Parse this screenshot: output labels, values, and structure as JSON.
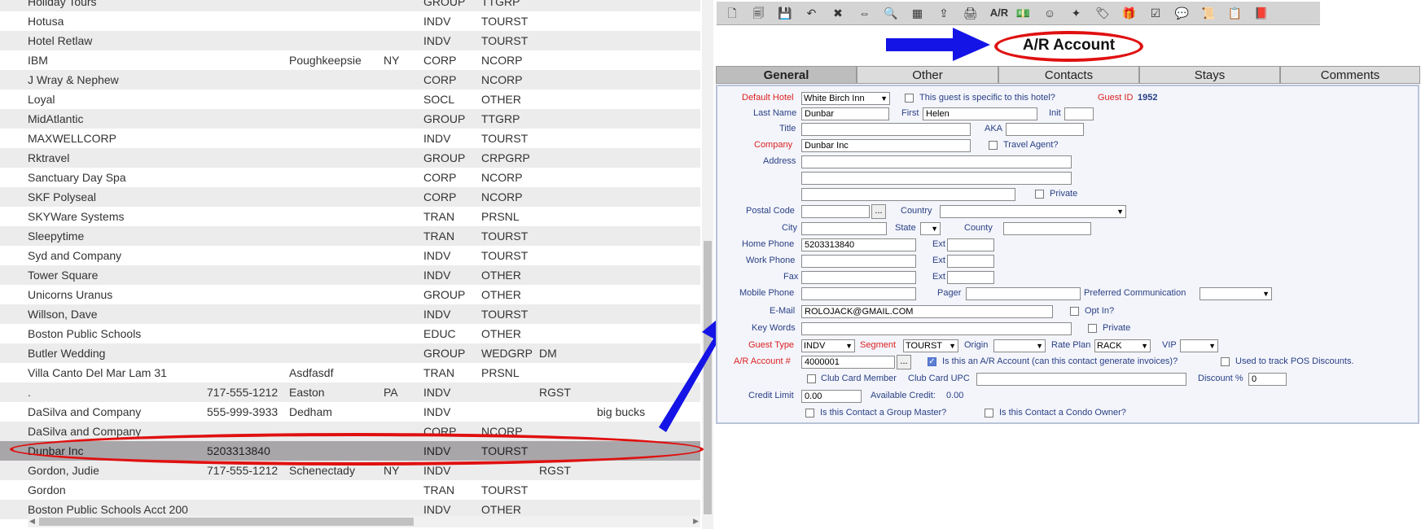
{
  "list": {
    "rows": [
      {
        "name": "Holiday Tours",
        "phone": "",
        "city": "",
        "state": "",
        "type": "GROUP",
        "segment": "TTGRP",
        "extra": "",
        "note": ""
      },
      {
        "name": "Hotusa",
        "phone": "",
        "city": "",
        "state": "",
        "type": "INDV",
        "segment": "TOURST",
        "extra": "",
        "note": ""
      },
      {
        "name": "Hotel Retlaw",
        "phone": "",
        "city": "",
        "state": "",
        "type": "INDV",
        "segment": "TOURST",
        "extra": "",
        "note": ""
      },
      {
        "name": "IBM",
        "phone": "",
        "city": "Poughkeepsie",
        "state": "NY",
        "type": "CORP",
        "segment": "NCORP",
        "extra": "",
        "note": ""
      },
      {
        "name": "J Wray & Nephew",
        "phone": "",
        "city": "",
        "state": "",
        "type": "CORP",
        "segment": "NCORP",
        "extra": "",
        "note": ""
      },
      {
        "name": "Loyal",
        "phone": "",
        "city": "",
        "state": "",
        "type": "SOCL",
        "segment": "OTHER",
        "extra": "",
        "note": ""
      },
      {
        "name": "MidAtlantic",
        "phone": "",
        "city": "",
        "state": "",
        "type": "GROUP",
        "segment": "TTGRP",
        "extra": "",
        "note": ""
      },
      {
        "name": "MAXWELLCORP",
        "phone": "",
        "city": "",
        "state": "",
        "type": "INDV",
        "segment": "TOURST",
        "extra": "",
        "note": ""
      },
      {
        "name": "Rktravel",
        "phone": "",
        "city": "",
        "state": "",
        "type": "GROUP",
        "segment": "CRPGRP",
        "extra": "",
        "note": ""
      },
      {
        "name": "Sanctuary Day Spa",
        "phone": "",
        "city": "",
        "state": "",
        "type": "CORP",
        "segment": "NCORP",
        "extra": "",
        "note": ""
      },
      {
        "name": "SKF Polyseal",
        "phone": "",
        "city": "",
        "state": "",
        "type": "CORP",
        "segment": "NCORP",
        "extra": "",
        "note": ""
      },
      {
        "name": "SKYWare Systems",
        "phone": "",
        "city": "",
        "state": "",
        "type": "TRAN",
        "segment": "PRSNL",
        "extra": "",
        "note": ""
      },
      {
        "name": "Sleepytime",
        "phone": "",
        "city": "",
        "state": "",
        "type": "TRAN",
        "segment": "TOURST",
        "extra": "",
        "note": ""
      },
      {
        "name": "Syd and Company",
        "phone": "",
        "city": "",
        "state": "",
        "type": "INDV",
        "segment": "TOURST",
        "extra": "",
        "note": ""
      },
      {
        "name": "Tower Square",
        "phone": "",
        "city": "",
        "state": "",
        "type": "INDV",
        "segment": "OTHER",
        "extra": "",
        "note": ""
      },
      {
        "name": "Unicorns Uranus",
        "phone": "",
        "city": "",
        "state": "",
        "type": "GROUP",
        "segment": "OTHER",
        "extra": "",
        "note": ""
      },
      {
        "name": "Willson, Dave",
        "phone": "",
        "city": "",
        "state": "",
        "type": "INDV",
        "segment": "TOURST",
        "extra": "",
        "note": ""
      },
      {
        "name": "Boston Public Schools",
        "phone": "",
        "city": "",
        "state": "",
        "type": "EDUC",
        "segment": "OTHER",
        "extra": "",
        "note": ""
      },
      {
        "name": "Butler Wedding",
        "phone": "",
        "city": "",
        "state": "",
        "type": "GROUP",
        "segment": "WEDGRP",
        "extra": "DM",
        "note": ""
      },
      {
        "name": "Villa Canto Del Mar Lam 31",
        "phone": "",
        "city": "Asdfasdf",
        "state": "",
        "type": "TRAN",
        "segment": "PRSNL",
        "extra": "",
        "note": ""
      },
      {
        "name": ".",
        "phone": "717-555-1212",
        "city": "Easton",
        "state": "PA",
        "type": "INDV",
        "segment": "",
        "extra": "RGST",
        "note": ""
      },
      {
        "name": "DaSilva and Company",
        "phone": "555-999-3933",
        "city": "Dedham",
        "state": "",
        "type": "INDV",
        "segment": "",
        "extra": "",
        "note": "big bucks"
      },
      {
        "name": "DaSilva and Company",
        "phone": "",
        "city": "",
        "state": "",
        "type": "CORP",
        "segment": "NCORP",
        "extra": "",
        "note": ""
      },
      {
        "name": "Dunbar Inc",
        "phone": "5203313840",
        "city": "",
        "state": "",
        "type": "INDV",
        "segment": "TOURST",
        "extra": "",
        "note": ""
      },
      {
        "name": "Gordon, Judie",
        "phone": "717-555-1212",
        "city": "Schenectady",
        "state": "NY",
        "type": "INDV",
        "segment": "",
        "extra": "RGST",
        "note": ""
      },
      {
        "name": "Gordon",
        "phone": "",
        "city": "",
        "state": "",
        "type": "TRAN",
        "segment": "TOURST",
        "extra": "",
        "note": ""
      },
      {
        "name": "Boston Public Schools Acct 200",
        "phone": "",
        "city": "",
        "state": "",
        "type": "INDV",
        "segment": "OTHER",
        "extra": "",
        "note": ""
      }
    ]
  },
  "annotation": {
    "callout": "A/R Account",
    "arrow_color": "#1414e6",
    "highlight_color": "#e01010"
  },
  "toolbar": {
    "buttons": [
      {
        "name": "new-doc-icon",
        "glyph": "🗋"
      },
      {
        "name": "copy-doc-icon",
        "glyph": "🗐"
      },
      {
        "name": "save-icon",
        "glyph": "💾"
      },
      {
        "name": "undo-icon",
        "glyph": "↶"
      },
      {
        "name": "delete-icon",
        "glyph": "✖"
      },
      {
        "name": "merge-icon",
        "glyph": "⇔"
      },
      {
        "name": "search-icon",
        "glyph": "🔍"
      },
      {
        "name": "cards-icon",
        "glyph": "▦"
      },
      {
        "name": "export-icon",
        "glyph": "⇪"
      },
      {
        "name": "print-icon",
        "glyph": "🖨"
      },
      {
        "name": "ar-label",
        "glyph": "A/R"
      },
      {
        "name": "money-icon",
        "glyph": "💵"
      },
      {
        "name": "smiley-icon",
        "glyph": "☺"
      },
      {
        "name": "magic-wand-icon",
        "glyph": "✦"
      },
      {
        "name": "tag-icon",
        "glyph": "🏷"
      },
      {
        "name": "gift-icon",
        "glyph": "🎁"
      },
      {
        "name": "checklist-icon",
        "glyph": "☑"
      },
      {
        "name": "chat-icon",
        "glyph": "💬"
      },
      {
        "name": "scroll-icon",
        "glyph": "📜"
      },
      {
        "name": "clipboard-icon",
        "glyph": "📋"
      },
      {
        "name": "book-icon",
        "glyph": "📕"
      }
    ]
  },
  "tabs": [
    "General",
    "Other",
    "Contacts",
    "Stays",
    "Comments"
  ],
  "form": {
    "default_hotel_label": "Default Hotel",
    "default_hotel": "White Birch Inn",
    "hotel_specific_label": "This guest is specific to this hotel?",
    "guest_id_label": "Guest ID",
    "guest_id": "1952",
    "last_name_label": "Last Name",
    "last_name": "Dunbar",
    "first_label": "First",
    "first": "Helen",
    "init_label": "Init",
    "init": "",
    "title_label": "Title",
    "title": "",
    "aka_label": "AKA",
    "aka": "",
    "company_label": "Company",
    "company": "Dunbar Inc",
    "travel_agent_label": "Travel Agent?",
    "address_label": "Address",
    "address1": "",
    "address2": "",
    "address3": "",
    "private_label": "Private",
    "postal_code_label": "Postal Code",
    "postal_code": "",
    "dots": "...",
    "country_label": "Country",
    "country": "",
    "city_label": "City",
    "city": "",
    "state_label": "State",
    "state": "",
    "county_label": "County",
    "county": "",
    "home_phone_label": "Home Phone",
    "home_phone": "5203313840",
    "ext_label": "Ext",
    "work_phone_label": "Work Phone",
    "work_phone": "",
    "fax_label": "Fax",
    "fax": "",
    "mobile_phone_label": "Mobile Phone",
    "mobile_phone": "",
    "pager_label": "Pager",
    "pager": "",
    "pref_comm_label": "Preferred Communication",
    "pref_comm": "",
    "email_label": "E-Mail",
    "email": "ROLOJACK@GMAIL.COM",
    "opt_in_label": "Opt In?",
    "keywords_label": "Key Words",
    "keywords": "",
    "private2_label": "Private",
    "guest_type_label": "Guest Type",
    "guest_type": "INDV",
    "segment_label": "Segment",
    "segment": "TOURST",
    "origin_label": "Origin",
    "origin": "",
    "rate_plan_label": "Rate Plan",
    "rate_plan": "RACK",
    "vip_label": "VIP",
    "vip": "",
    "ar_account_label": "A/R Account #",
    "ar_account": "4000001",
    "is_ar_label": "Is this an A/R Account (can this contact generate invoices)?",
    "pos_label": "Used to track POS Discounts.",
    "club_member_label": "Club Card Member",
    "club_upc_label": "Club Card UPC",
    "club_upc": "",
    "discount_label": "Discount %",
    "discount": "0",
    "credit_limit_label": "Credit Limit",
    "credit_limit": "0.00",
    "available_credit_label": "Available Credit:",
    "available_credit": "0.00",
    "group_master_label": "Is this Contact a Group Master?",
    "condo_owner_label": "Is this Contact a Condo Owner?"
  }
}
